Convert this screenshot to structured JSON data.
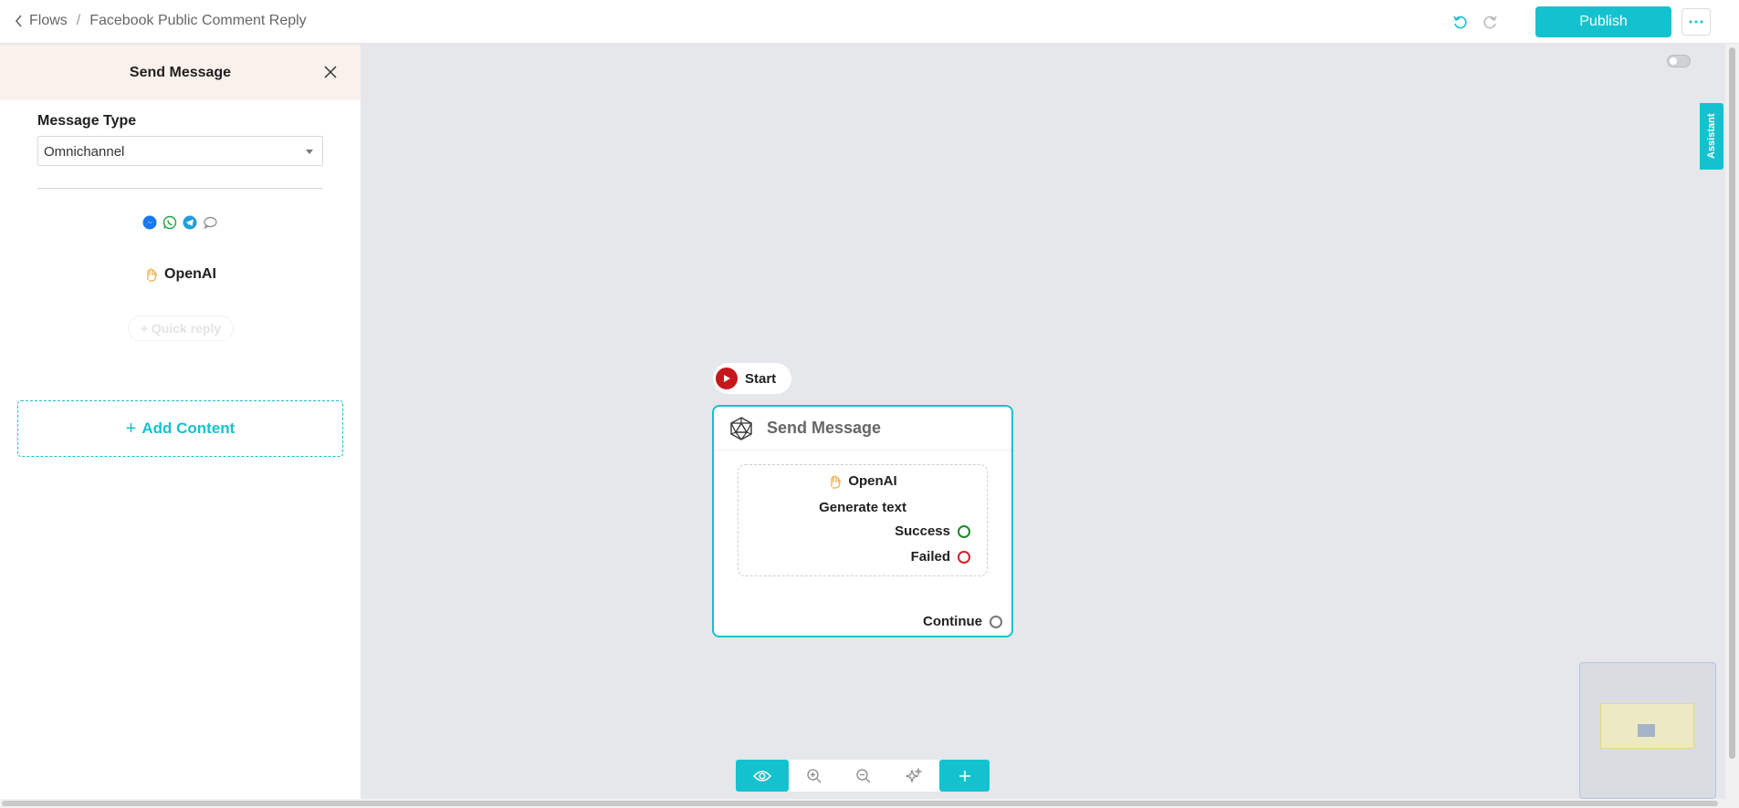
{
  "header": {
    "back_label": "Flows",
    "separator": "/",
    "flow_name": "Facebook Public Comment Reply",
    "publish_label": "Publish"
  },
  "panel": {
    "title": "Send Message",
    "message_type_label": "Message Type",
    "message_type_value": "Omnichannel",
    "channel_icons": [
      "messenger-icon",
      "whatsapp-icon",
      "telegram-icon",
      "chat-icon"
    ],
    "provider_name": "OpenAI",
    "quick_reply_label": "+ Quick reply",
    "add_content_label": "Add Content"
  },
  "canvas": {
    "assistant_label": "Assistant",
    "start_label": "Start",
    "node": {
      "title": "Send Message",
      "provider_name": "OpenAI",
      "action": "Generate text",
      "success_label": "Success",
      "failed_label": "Failed",
      "continue_label": "Continue"
    }
  },
  "colors": {
    "accent": "#14c2cf",
    "success": "#1a8a2a",
    "failed": "#d4202a",
    "start": "#c8161d"
  }
}
